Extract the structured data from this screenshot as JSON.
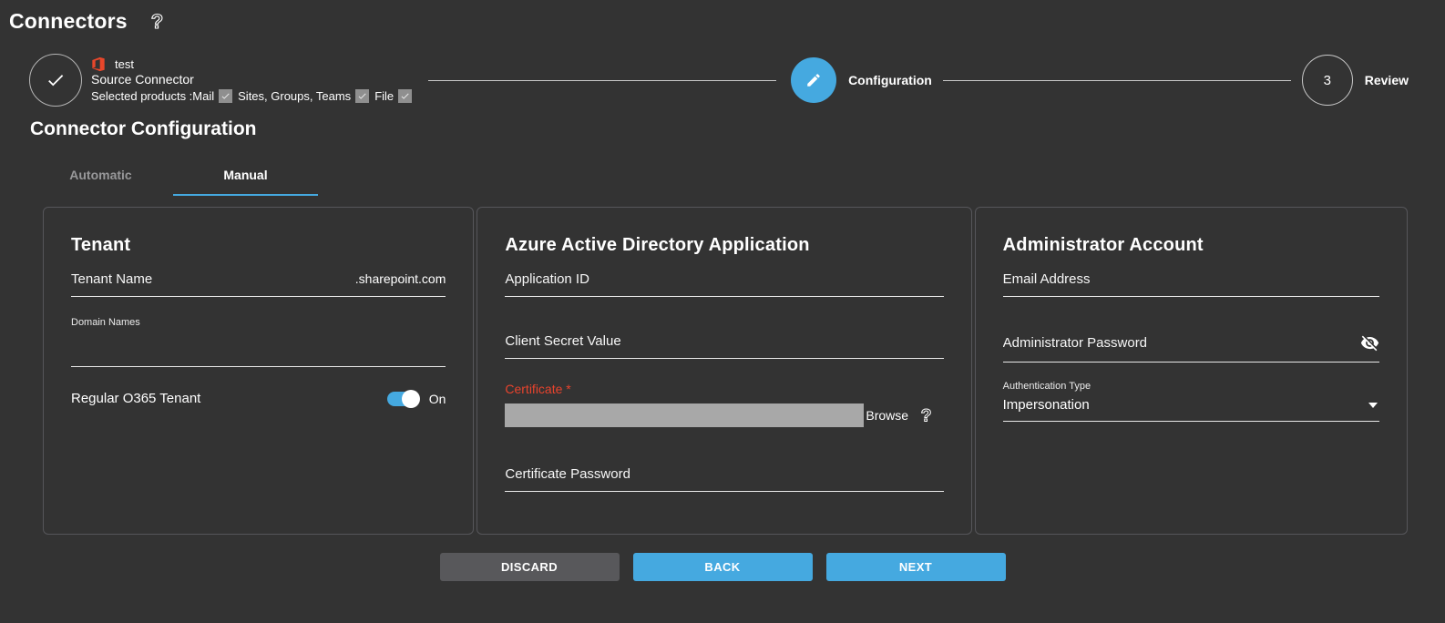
{
  "page": {
    "title": "Connectors"
  },
  "stepper": {
    "steps": [
      {
        "state": "completed",
        "connector_name": "test",
        "label": "Source Connector",
        "products_prefix": "Selected products :",
        "products": [
          "Mail",
          "Sites, Groups, Teams",
          "File"
        ]
      },
      {
        "state": "active",
        "label": "Configuration"
      },
      {
        "state": "upcoming",
        "number": "3",
        "label": "Review"
      }
    ]
  },
  "section_title": "Connector Configuration",
  "tabs": [
    {
      "label": "Automatic",
      "active": false
    },
    {
      "label": "Manual",
      "active": true
    }
  ],
  "panels": {
    "tenant": {
      "title": "Tenant",
      "tenant_name": {
        "placeholder": "Tenant Name",
        "value": "",
        "suffix": ".sharepoint.com"
      },
      "domain_names": {
        "label": "Domain Names",
        "value": ""
      },
      "regular_o365": {
        "label": "Regular O365 Tenant",
        "state_label": "On",
        "enabled": true
      }
    },
    "azure_app": {
      "title": "Azure Active Directory Application",
      "application_id": {
        "placeholder": "Application ID",
        "value": ""
      },
      "client_secret": {
        "placeholder": "Client Secret Value",
        "value": ""
      },
      "certificate": {
        "label": "Certificate",
        "required_mark": "*",
        "browse_label": "Browse",
        "file_value": ""
      },
      "certificate_password": {
        "placeholder": "Certificate Password",
        "value": ""
      }
    },
    "admin": {
      "title": "Administrator Account",
      "email": {
        "placeholder": "Email Address",
        "value": ""
      },
      "password": {
        "placeholder": "Administrator Password",
        "value": ""
      },
      "auth_type": {
        "label": "Authentication Type",
        "value": "Impersonation"
      }
    }
  },
  "footer": {
    "discard": "DISCARD",
    "back": "BACK",
    "next": "NEXT"
  },
  "colors": {
    "background": "#333333",
    "accent_blue": "#45a9e0",
    "error_red": "#e8432d",
    "office_orange": "#e8472b",
    "file_bar_gray": "#a8a8a8",
    "discard_gray": "#58585b"
  }
}
